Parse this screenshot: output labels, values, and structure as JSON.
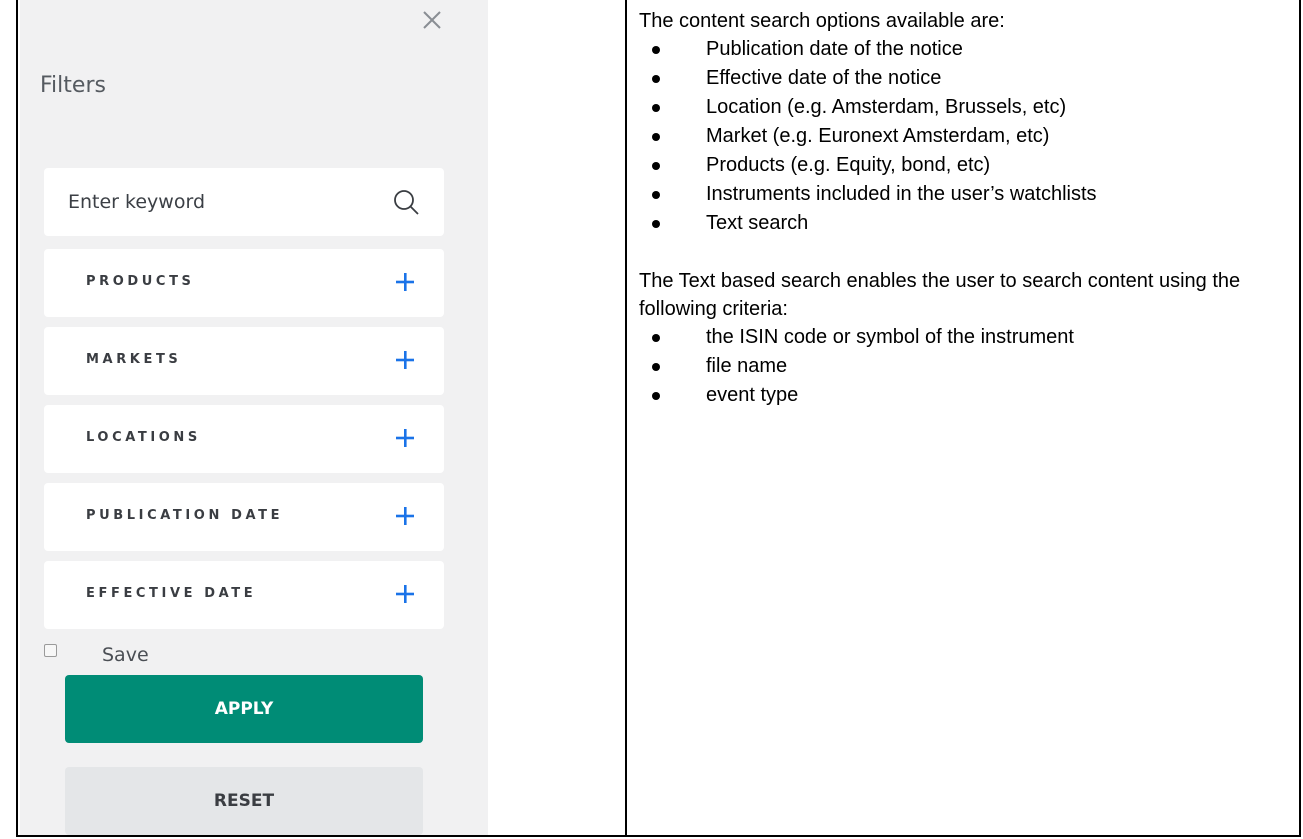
{
  "filter_panel": {
    "title": "Filters",
    "search": {
      "placeholder": "Enter keyword",
      "value": ""
    },
    "filters": [
      {
        "label": "PRODUCTS"
      },
      {
        "label": "MARKETS"
      },
      {
        "label": "LOCATIONS"
      },
      {
        "label": "PUBLICATION DATE"
      },
      {
        "label": "EFFECTIVE DATE"
      }
    ],
    "save_label": "Save",
    "save_checked": false,
    "apply_label": "APPLY",
    "reset_label": "RESET",
    "colors": {
      "accent_plus": "#1a73e8",
      "apply_bg": "#008c76",
      "panel_bg": "#f1f1f2"
    },
    "icons": {
      "close": "close-icon",
      "search": "search-icon",
      "expand": "plus-icon"
    }
  },
  "description": {
    "intro": "The content search options available are:",
    "options": [
      "Publication date of the notice",
      "Effective date of the notice",
      "Location (e.g. Amsterdam, Brussels, etc)",
      "Market (e.g. Euronext Amsterdam, etc)",
      "Products (e.g. Equity, bond, etc)",
      "Instruments included in the user’s watchlists",
      "Text search"
    ],
    "text_search_intro": "The Text based search enables the user to search content using the following criteria:",
    "criteria": [
      "the ISIN code or symbol of the instrument",
      "file name",
      "event type"
    ]
  }
}
